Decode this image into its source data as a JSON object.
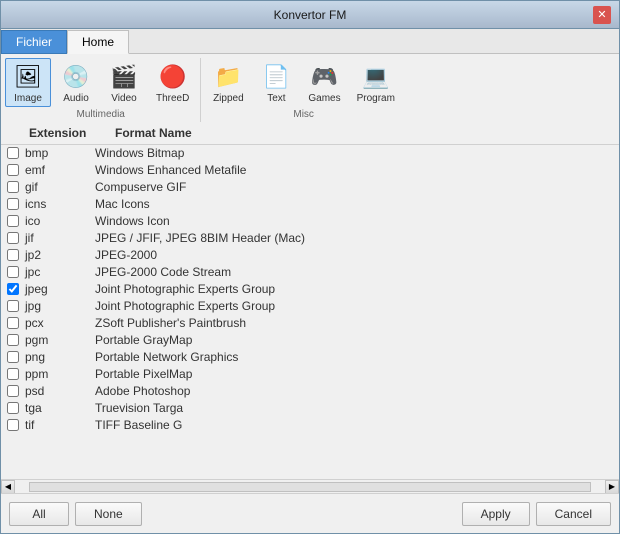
{
  "window": {
    "title": "Konvertor FM"
  },
  "ribbon": {
    "tabs": [
      {
        "id": "fichier",
        "label": "Fichier",
        "active": false,
        "special": true
      },
      {
        "id": "home",
        "label": "Home",
        "active": true
      }
    ],
    "groups": [
      {
        "id": "multimedia",
        "label": "Multimedia",
        "buttons": [
          {
            "id": "image",
            "label": "Image",
            "active": true,
            "icon": "🖼"
          },
          {
            "id": "audio",
            "label": "Audio",
            "active": false,
            "icon": "💿"
          },
          {
            "id": "video",
            "label": "Video",
            "active": false,
            "icon": "🎬"
          },
          {
            "id": "threed",
            "label": "ThreeD",
            "active": false,
            "icon": "🔴"
          }
        ]
      },
      {
        "id": "misc",
        "label": "Misc",
        "buttons": [
          {
            "id": "zipped",
            "label": "Zipped",
            "active": false,
            "icon": "📁"
          },
          {
            "id": "text",
            "label": "Text",
            "active": false,
            "icon": "📄"
          },
          {
            "id": "games",
            "label": "Games",
            "active": false,
            "icon": "🎮"
          },
          {
            "id": "program",
            "label": "Program",
            "active": false,
            "icon": "💻"
          }
        ]
      }
    ]
  },
  "table": {
    "headers": [
      "Extension",
      "Format Name"
    ],
    "rows": [
      {
        "ext": "bmp",
        "name": "Windows Bitmap",
        "checked": false
      },
      {
        "ext": "emf",
        "name": "Windows Enhanced Metafile",
        "checked": false
      },
      {
        "ext": "gif",
        "name": "Compuserve GIF",
        "checked": false
      },
      {
        "ext": "icns",
        "name": "Mac Icons",
        "checked": false
      },
      {
        "ext": "ico",
        "name": "Windows Icon",
        "checked": false
      },
      {
        "ext": "jif",
        "name": "JPEG / JFIF, JPEG 8BIM Header (Mac)",
        "checked": false
      },
      {
        "ext": "jp2",
        "name": "JPEG-2000",
        "checked": false
      },
      {
        "ext": "jpc",
        "name": "JPEG-2000 Code Stream",
        "checked": false
      },
      {
        "ext": "jpeg",
        "name": "Joint Photographic Experts Group",
        "checked": true
      },
      {
        "ext": "jpg",
        "name": "Joint Photographic Experts Group",
        "checked": false
      },
      {
        "ext": "pcx",
        "name": "ZSoft Publisher's Paintbrush",
        "checked": false
      },
      {
        "ext": "pgm",
        "name": "Portable GrayMap",
        "checked": false
      },
      {
        "ext": "png",
        "name": "Portable Network Graphics",
        "checked": false
      },
      {
        "ext": "ppm",
        "name": "Portable PixelMap",
        "checked": false
      },
      {
        "ext": "psd",
        "name": "Adobe Photoshop",
        "checked": false
      },
      {
        "ext": "tga",
        "name": "Truevision Targa",
        "checked": false
      },
      {
        "ext": "tif",
        "name": "TIFF Baseline G",
        "checked": false
      }
    ]
  },
  "buttons": {
    "all": "All",
    "none": "None",
    "apply": "Apply",
    "cancel": "Cancel"
  }
}
